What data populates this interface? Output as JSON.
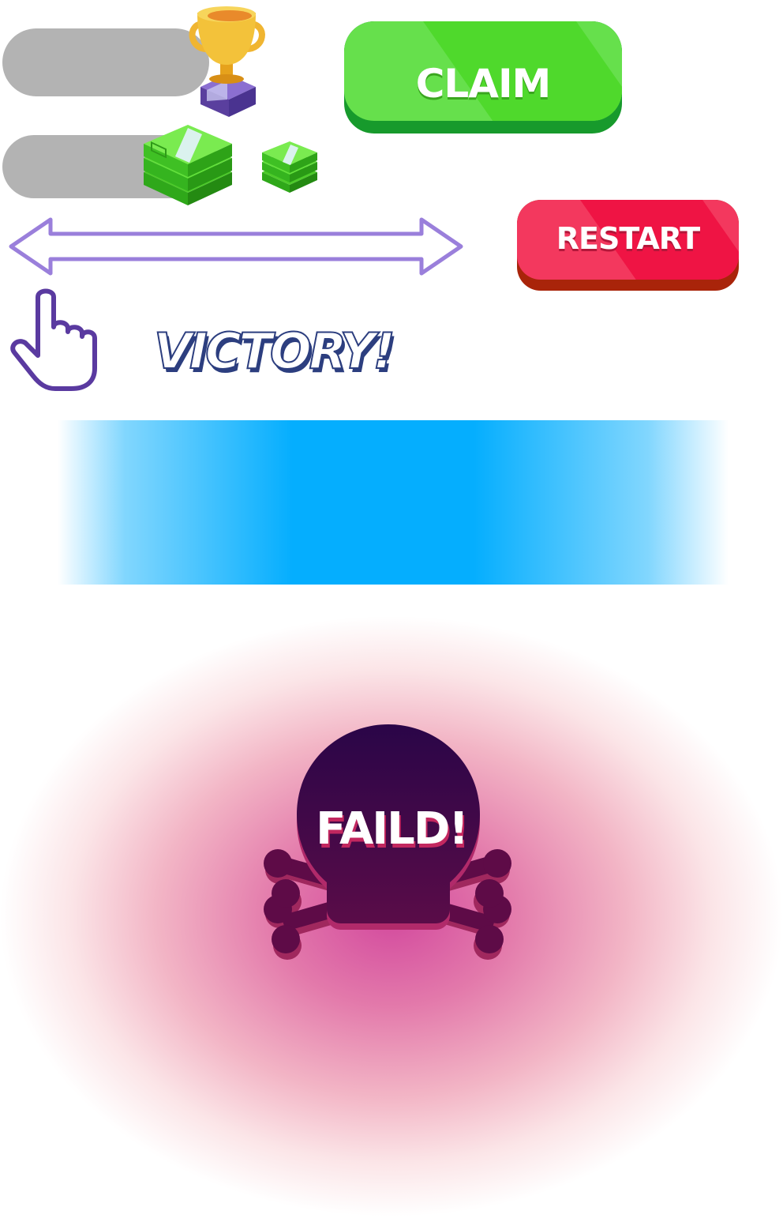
{
  "buttons": {
    "claim_label": "CLAIM",
    "restart_label": "RESTART"
  },
  "titles": {
    "victory": "VICTORY!",
    "failed": "FAILD!"
  },
  "icons": {
    "trophy": "trophy-icon",
    "money_stack_large": "money-stack-icon",
    "money_stack_small": "money-stack-icon",
    "swipe_arrow": "double-arrow-icon",
    "hand_pointer": "hand-pointer-icon",
    "skull": "skull-crossbones-icon"
  },
  "colors": {
    "claim_green": "#66e04c",
    "restart_red": "#f3385e",
    "banner_blue": "#05aefe",
    "arrow_purple": "#9b7fd9",
    "skull_purple": "#3b0a4a",
    "glow_pink": "#d34a9e"
  }
}
